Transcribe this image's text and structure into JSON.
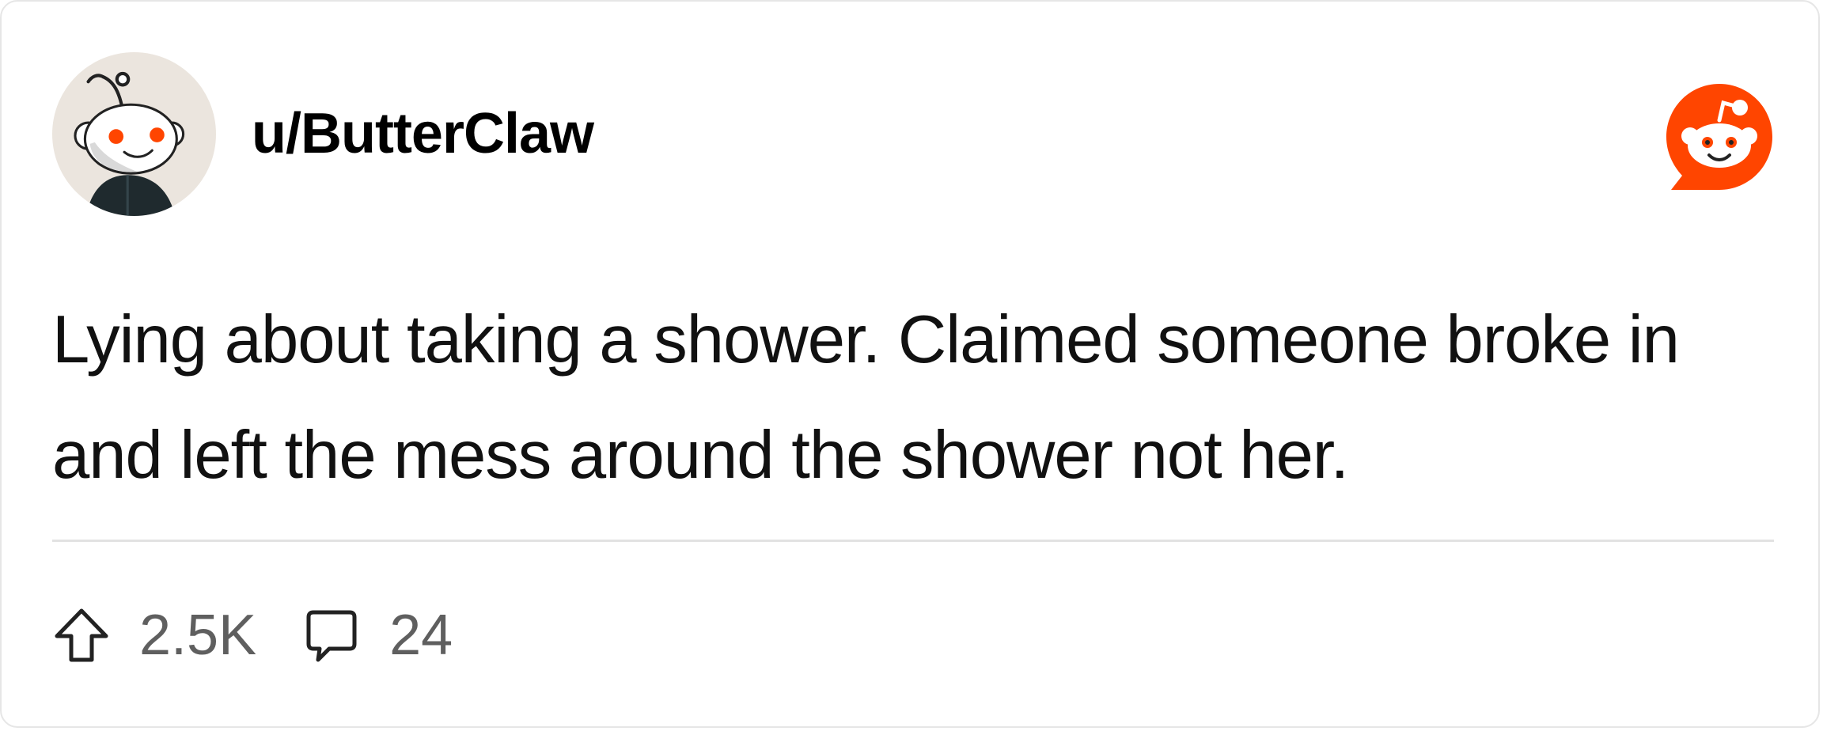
{
  "post": {
    "username": "u/ButterClaw",
    "body": "Lying about taking a shower. Claimed someone broke in and left the mess around the shower not her."
  },
  "stats": {
    "upvotes": "2.5K",
    "comments": "24"
  },
  "icons": {
    "avatar": "snoo-avatar",
    "brand": "reddit-logo-icon",
    "upvote": "upvote-arrow-icon",
    "comment": "comment-bubble-icon"
  },
  "colors": {
    "brand": "#ff4500",
    "text": "#111111",
    "muted": "#5f5f5f",
    "divider": "#e2e2e2",
    "avatar_bg": "#ebe5de"
  }
}
